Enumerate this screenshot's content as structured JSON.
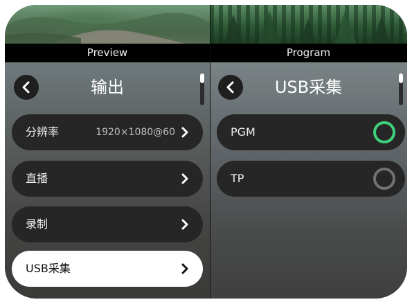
{
  "preview": {
    "label": "Preview",
    "title": "输出",
    "items": [
      {
        "label": "分辨率",
        "value": "1920×1080@60"
      },
      {
        "label": "直播",
        "value": ""
      },
      {
        "label": "录制",
        "value": ""
      },
      {
        "label": "USB采集",
        "value": ""
      }
    ],
    "active_index": 3,
    "icons": {
      "back": "chevron-left-icon",
      "item": "chevron-right-icon"
    }
  },
  "program": {
    "label": "Program",
    "title": "USB采集",
    "options": [
      {
        "label": "PGM",
        "selected": true
      },
      {
        "label": "TP",
        "selected": false
      }
    ],
    "icons": {
      "back": "chevron-left-icon",
      "option": "radio-icon"
    }
  },
  "colors": {
    "accent_green": "#3ed27a",
    "row_bg": "#262626",
    "row_active_bg": "#ffffff",
    "radio_off": "#707070"
  }
}
